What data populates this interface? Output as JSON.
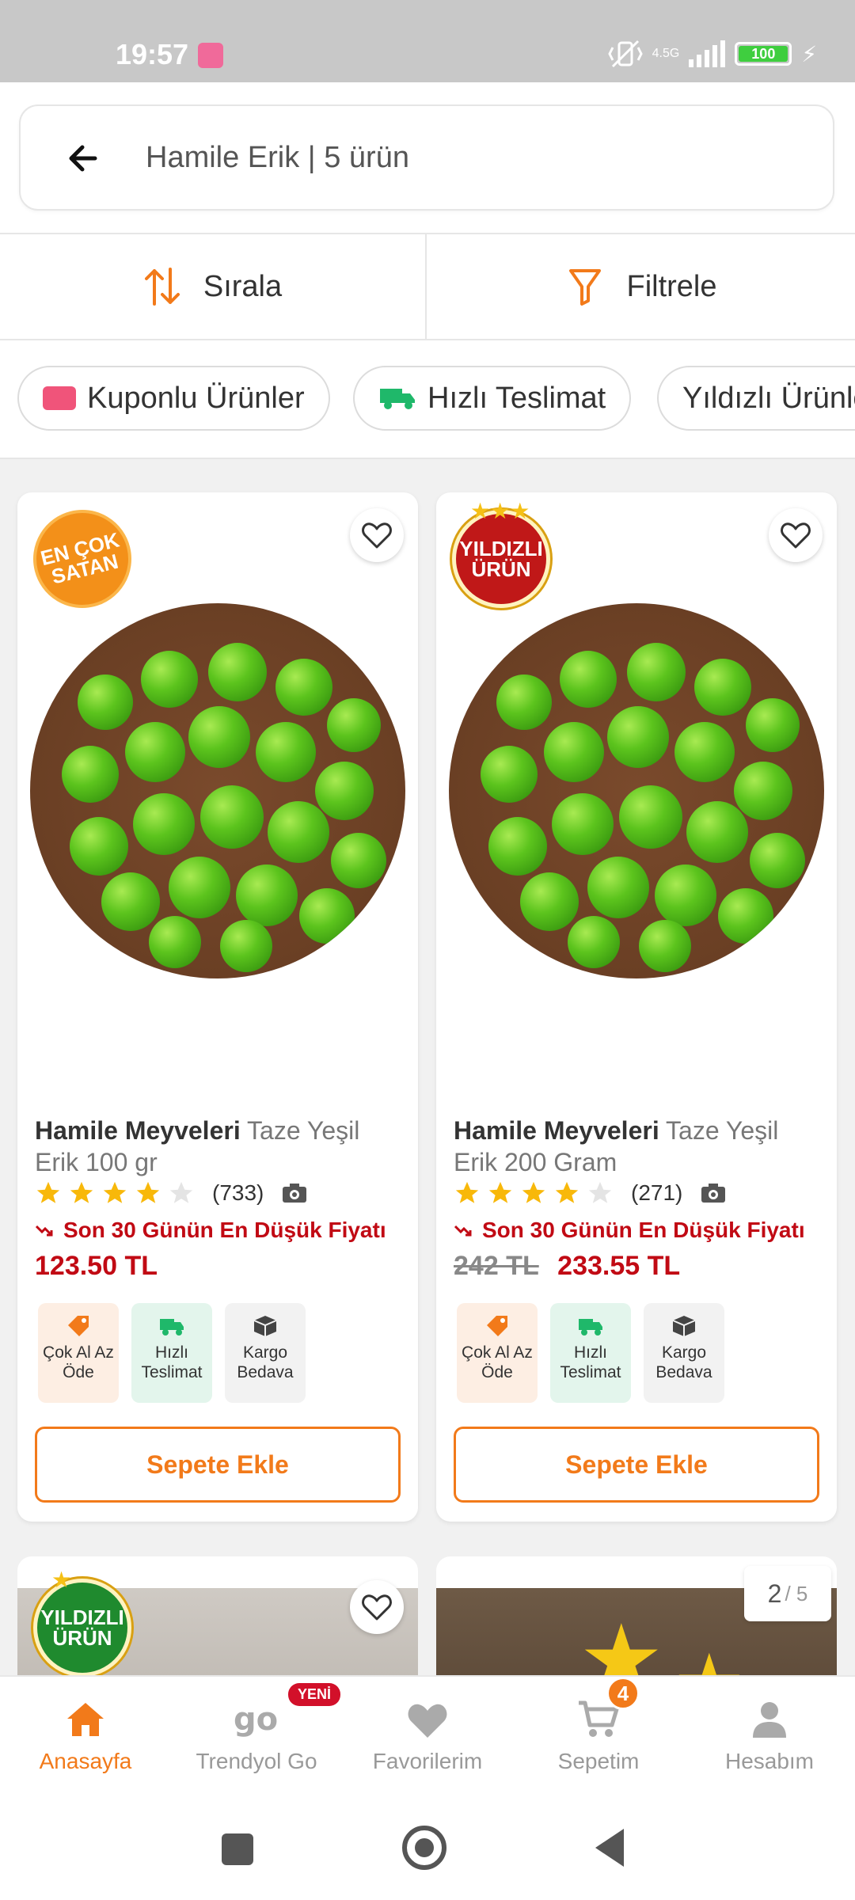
{
  "status_bar": {
    "time": "19:57",
    "network": "4.5G",
    "battery": "100"
  },
  "header": {
    "title": "Hamile Erik | 5 ürün"
  },
  "toolbar": {
    "sort_label": "Sırala",
    "filter_label": "Filtrele"
  },
  "chips": [
    {
      "label": "Kuponlu Ürünler"
    },
    {
      "label": "Hızlı Teslimat"
    },
    {
      "label": "Yıldızlı Ürünler"
    }
  ],
  "products": [
    {
      "badge": "EN ÇOK SATAN",
      "brand": "Hamile Meyveleri",
      "name": "Taze Yeşil Erik 100 gr",
      "rating": 4,
      "review_count": "(733)",
      "lowest_text": "Son 30 Günün En Düşük Fiyatı",
      "old_price": "",
      "price": "123.50 TL",
      "tags": [
        "Çok Al Az Öde",
        "Hızlı Teslimat",
        "Kargo Bedava"
      ],
      "button": "Sepete Ekle"
    },
    {
      "badge": "YILDIZLI ÜRÜN",
      "brand": "Hamile Meyveleri",
      "name": "Taze Yeşil Erik 200 Gram",
      "rating": 4,
      "review_count": "(271)",
      "lowest_text": "Son 30 Günün En Düşük Fiyatı",
      "old_price": "242 TL",
      "price": "233.55 TL",
      "tags": [
        "Çok Al Az Öde",
        "Hızlı Teslimat",
        "Kargo Bedava"
      ],
      "button": "Sepete Ekle"
    }
  ],
  "second_row": {
    "badge": "YILDIZLI ÜRÜN"
  },
  "pagination": {
    "current": "2",
    "total": "/ 5"
  },
  "bottom_nav": {
    "items": [
      {
        "label": "Anasayfa"
      },
      {
        "label": "Trendyol Go"
      },
      {
        "label": "Favorilerim"
      },
      {
        "label": "Sepetim"
      },
      {
        "label": "Hesabım"
      }
    ],
    "new_badge": "YENİ",
    "cart_count": "4"
  },
  "colors": {
    "accent": "#f27a1a",
    "price": "#c10a14"
  }
}
